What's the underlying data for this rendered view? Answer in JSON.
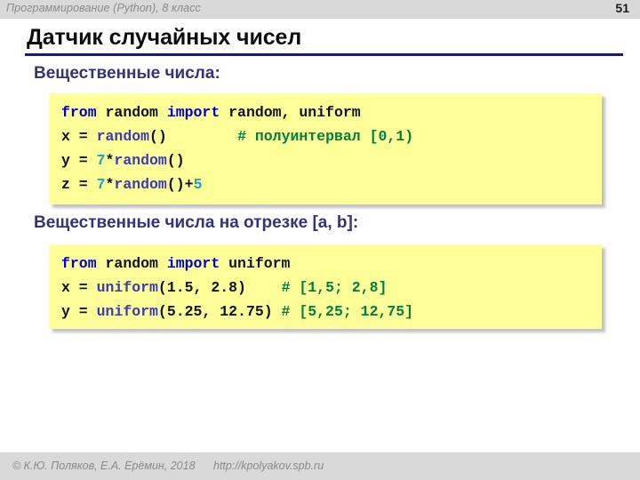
{
  "header": {
    "course": "Программирование (Python), 8 класс",
    "page_number": "51"
  },
  "title": {
    "text": "Датчик случайных чисел",
    "rule_color": "#1A1A6E"
  },
  "sections": [
    {
      "subtitle": "Вещественные числа:",
      "code_lines": [
        [
          {
            "t": "from ",
            "c": "kw"
          },
          {
            "t": "random ",
            "c": "plain"
          },
          {
            "t": "import ",
            "c": "kw"
          },
          {
            "t": "random, uniform",
            "c": "plain"
          }
        ],
        [
          {
            "t": "x = ",
            "c": "plain"
          },
          {
            "t": "random",
            "c": "fn"
          },
          {
            "t": "()",
            "c": "plain"
          },
          {
            "t": "        ",
            "c": "plain"
          },
          {
            "t": "# полуинтервал [0,1)",
            "c": "comment"
          }
        ],
        [
          {
            "t": "y = ",
            "c": "plain"
          },
          {
            "t": "7",
            "c": "num"
          },
          {
            "t": "*",
            "c": "plain"
          },
          {
            "t": "random",
            "c": "fn"
          },
          {
            "t": "()",
            "c": "plain"
          }
        ],
        [
          {
            "t": "z = ",
            "c": "plain"
          },
          {
            "t": "7",
            "c": "num"
          },
          {
            "t": "*",
            "c": "plain"
          },
          {
            "t": "random",
            "c": "fn"
          },
          {
            "t": "()+",
            "c": "plain"
          },
          {
            "t": "5",
            "c": "num"
          }
        ]
      ]
    },
    {
      "subtitle": "Вещественные числа на отрезке [a, b]:",
      "code_lines": [
        [
          {
            "t": "from ",
            "c": "kw"
          },
          {
            "t": "random ",
            "c": "plain"
          },
          {
            "t": "import ",
            "c": "kw"
          },
          {
            "t": "uniform",
            "c": "plain"
          }
        ],
        [
          {
            "t": "x = ",
            "c": "plain"
          },
          {
            "t": "uniform",
            "c": "fn"
          },
          {
            "t": "(1.5, 2.8)",
            "c": "plain"
          },
          {
            "t": "    ",
            "c": "plain"
          },
          {
            "t": "# [1,5; 2,8]",
            "c": "comment"
          }
        ],
        [
          {
            "t": "y = ",
            "c": "plain"
          },
          {
            "t": "uniform",
            "c": "fn"
          },
          {
            "t": "(5.25, 12.75) ",
            "c": "plain"
          },
          {
            "t": "# [5,25; 12,75]",
            "c": "comment"
          }
        ]
      ]
    }
  ],
  "footer": {
    "copyright": "© К.Ю. Поляков, Е.А. Ерёмин, 2018",
    "url": "http://kpolyakov.spb.ru"
  },
  "colors": {
    "code_background": "#FFFF99",
    "keyword": "#0000CC",
    "function": "#3A3ABA",
    "number": "#19A3C4",
    "comment": "#008040",
    "subtitle": "#33337A",
    "header_bar": "#D9D9D9"
  }
}
